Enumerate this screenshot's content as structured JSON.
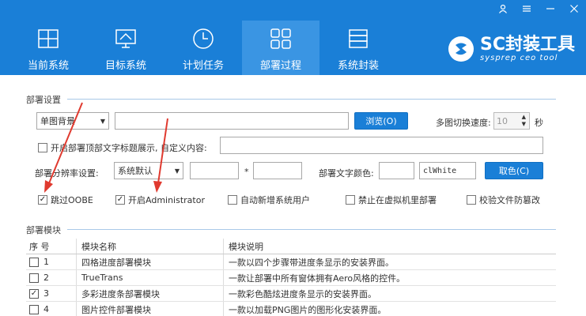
{
  "window_controls": {
    "user": "user-icon",
    "menu": "menu-icon",
    "minimize": "minimize-icon",
    "close": "close-icon"
  },
  "tabs": [
    {
      "label": "当前系统",
      "icon": "windows-icon",
      "active": false
    },
    {
      "label": "目标系统",
      "icon": "monitor-icon",
      "active": false
    },
    {
      "label": "计划任务",
      "icon": "clock-icon",
      "active": false
    },
    {
      "label": "部署过程",
      "icon": "grid-icon",
      "active": true
    },
    {
      "label": "系统封装",
      "icon": "package-icon",
      "active": false
    }
  ],
  "brand": {
    "title": "SC封装工具",
    "subtitle": "sysprep ceo tool"
  },
  "deploy_settings": {
    "title": "部署设置",
    "background_mode": "单图背景",
    "browse_button": "浏览(O)",
    "switch_speed_label": "多图切换速度:",
    "switch_speed_value": "10",
    "seconds_unit": "秒",
    "show_title_label": "开启部署顶部文字标题展示, 自定义内容:",
    "resolution_label": "部署分辨率设置:",
    "resolution_mode": "系统默认",
    "resolution_separator": "*",
    "text_color_label": "部署文字颜色:",
    "text_color_value": "clWhite",
    "color_button": "取色(C)",
    "options": [
      {
        "label": "跳过OOBE",
        "checked": true
      },
      {
        "label": "开启Administrator",
        "checked": true
      },
      {
        "label": "自动新增系统用户",
        "checked": false
      },
      {
        "label": "禁止在虚拟机里部署",
        "checked": false
      },
      {
        "label": "校验文件防篡改",
        "checked": false
      }
    ]
  },
  "modules": {
    "title": "部署模块",
    "headers": {
      "index": "序 号",
      "name": "模块名称",
      "desc": "模块说明"
    },
    "rows": [
      {
        "index": "1",
        "name": "四格进度部署模块",
        "desc": "一款以四个步骤带进度条显示的安装界面。",
        "checked": false
      },
      {
        "index": "2",
        "name": "TrueTrans",
        "desc": "一款让部署中所有窗体拥有Aero风格的控件。",
        "checked": false
      },
      {
        "index": "3",
        "name": "多彩进度条部署模块",
        "desc": "一款彩色酷炫进度条显示的安装界面。",
        "checked": true
      },
      {
        "index": "4",
        "name": "图片控件部署模块",
        "desc": "一款以加载PNG图片的图形化安装界面。",
        "checked": false
      }
    ]
  },
  "colors": {
    "header_bg": "#1a7fd7",
    "active_tab": "#3a95e3",
    "annotation_arrow": "#e03a2f"
  }
}
